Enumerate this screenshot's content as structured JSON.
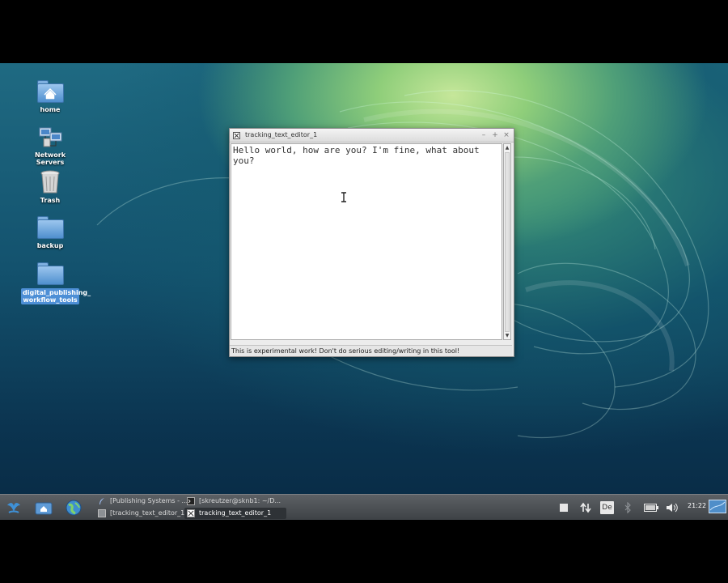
{
  "desktop": {
    "icons": [
      {
        "label": "home",
        "icon": "home-folder-icon"
      },
      {
        "label": "Network Servers",
        "icon": "network-servers-icon"
      },
      {
        "label": "Trash",
        "icon": "trash-icon"
      },
      {
        "label": "backup",
        "icon": "folder-icon"
      },
      {
        "label_line1": "digital_publishing_",
        "label_line2": "workflow_tools",
        "icon": "folder-icon",
        "selected": true
      }
    ]
  },
  "window": {
    "title": "tracking_text_editor_1",
    "minimize_symbol": "–",
    "maximize_symbol": "+",
    "close_symbol": "×",
    "editor_text": "Hello world, how are you? I'm fine, what about you?",
    "status_text": "This is experimental work! Don't do serious editing/writing in this tool!",
    "scroll_up": "▲",
    "scroll_down": "▼"
  },
  "taskbar": {
    "tasks": [
      {
        "label": "[Publishing Systems - ...",
        "icon": "feather-icon",
        "active": false
      },
      {
        "label": "[skreutzer@sknb1: ~/D...",
        "icon": "terminal-icon",
        "active": false
      },
      {
        "label": "[tracking_text_editor_1]",
        "icon": "window-icon",
        "active": false
      },
      {
        "label": "tracking_text_editor_1",
        "icon": "editor-icon",
        "active": true
      }
    ],
    "tray": {
      "keyboard_layout": "De",
      "clock": "21:22"
    }
  },
  "colors": {
    "selection": "#4d8fd6",
    "taskbar": "#4a4e52"
  }
}
